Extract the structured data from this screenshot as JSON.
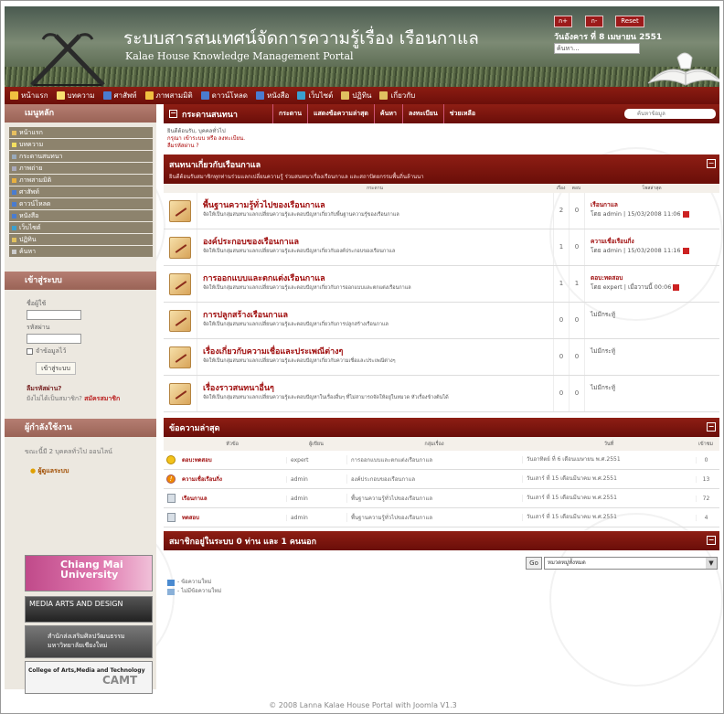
{
  "header": {
    "title": "ระบบสารสนเทศน์จัดการความรู้เรื่อง เรือนกาแล",
    "subtitle": "Kalae House Knowledge Management Portal",
    "font_buttons": [
      "ก+",
      "ก-",
      "Reset"
    ],
    "date": "วันอังคาร ที่ 8 เมษายน 2551",
    "search_value": "ค้นหา..."
  },
  "nav": [
    {
      "label": "หน้าแรก",
      "color": "#f0c040"
    },
    {
      "label": "บทความ",
      "color": "#f7e070"
    },
    {
      "label": "ศาสัพท์",
      "color": "#4a7cd0"
    },
    {
      "label": "ภาพสามมิติ",
      "color": "#f0c040"
    },
    {
      "label": "ดาวน์โหลด",
      "color": "#4a7cd0"
    },
    {
      "label": "หนังสือ",
      "color": "#4a7cd0"
    },
    {
      "label": "เว็บไซต์",
      "color": "#3aa0d0"
    },
    {
      "label": "ปฏิทิน",
      "color": "#e0c060"
    },
    {
      "label": "เกี่ยวกับ",
      "color": "#e0c060"
    }
  ],
  "sidebar": {
    "menu_title": "เมนูหลัก",
    "menu": [
      "หน้าแรก",
      "บทความ",
      "กระดานสนทนา",
      "ภาพถ่าย",
      "ภาพสามมิติ",
      "ศาสัพท์",
      "ดาวน์โหลด",
      "หนังสือ",
      "เว็บไซต์",
      "ปฏิทิน",
      "ค้นหา"
    ],
    "login_title": "เข้าสู่ระบบ",
    "username_label": "ชื่อผู้ใช้",
    "password_label": "รหัสผ่าน",
    "remember_label": "จำข้อมูลไว้",
    "login_button": "เข้าสู่ระบบ",
    "forgot": "ลืมรหัสผ่าน?",
    "no_account": "ยังไม่ได้เป็นสมาชิก?",
    "register": "สมัครสมาชิก",
    "online_title": "ผู้กำลังใช้งาน",
    "online_text": "ขณะนี้มี 2 บุคคลทั่วไป ออนไลน์",
    "online_user": "ผู้ดูแลระบบ",
    "banner1": "Chiang Mai University",
    "banner2": "MEDIA ARTS AND DESIGN",
    "banner3": "สำนักส่งเสริมศิลปวัฒนธรรม มหาวิทยาลัยเชียงใหม่",
    "banner4a": "College of Arts,Media and Technology",
    "banner4b": "CAMT"
  },
  "forum": {
    "bar_title": "กระดานสนทนา",
    "tabs": [
      "กระดาน",
      "แสดงข้อความล่าสุด",
      "ค้นหา",
      "ลงทะเบียน",
      "ช่วยเหลือ"
    ],
    "search_placeholder": "ค้นหาข้อมูล",
    "welcome_line1": "ยินดีต้อนรับ, บุคคลทั่วไป",
    "welcome_line2": "กรุณา เข้าระบบ หรือ ลงทะเบียน.",
    "welcome_line3": "ลืมรหัสผ่าน ?",
    "category_title": "สนทนาเกี่ยวกับเรือนกาแล",
    "category_desc": "ยินดีต้อนรับสมาชิกทุกท่านร่วมแลกเปลี่ยนความรู้ ร่วมสนทนาเรื่องเรือนกาแล และสถาปัตยกรรมพื้นถิ่นล้านนา",
    "columns": [
      "กระดาน",
      "เรื่อง",
      "ตอบ",
      "โพสล่าสุด"
    ],
    "boards": [
      {
        "title": "พื้นฐานความรู้ทั่วไปของเรือนกาแล",
        "desc": "จัดให้เป็นกลุ่มสนทนาแลกเปลี่ยนความรู้และตอบปัญหาเกี่ยวกับพื้นฐานความรู้ของเรือนกาแล",
        "topics": "2",
        "replies": "0",
        "last_title": "เรือนกาแล",
        "last_by": "โดย admin | 15/03/2008 11:06"
      },
      {
        "title": "องค์ประกอบของเรือนกาแล",
        "desc": "จัดให้เป็นกลุ่มสนทนาแลกเปลี่ยนความรู้และตอบปัญหาเกี่ยวกับองค์ประกอบของเรือนกาแล",
        "topics": "1",
        "replies": "0",
        "last_title": "ความเชื่อเรือนกิ่ง",
        "last_by": "โดย admin | 15/03/2008 11:16"
      },
      {
        "title": "การออกแบบและตกแต่งเรือนกาแล",
        "desc": "จัดให้เป็นกลุ่มสนทนาแลกเปลี่ยนความรู้และตอบปัญหาเกี่ยวกับการออกแบบและตกแต่งเรือนกาแล",
        "topics": "1",
        "replies": "1",
        "last_title": "ตอบ:ทดสอบ",
        "last_by": "โดย expert | เมื่อวานนี้ 00:06"
      },
      {
        "title": "การปลูกสร้างเรือนกาแล",
        "desc": "จัดให้เป็นกลุ่มสนทนาแลกเปลี่ยนความรู้และตอบปัญหาเกี่ยวกับการปลูกสร้างเรือนกาแล",
        "topics": "0",
        "replies": "0",
        "last_title": "",
        "last_by": "ไม่มีกระทู้"
      },
      {
        "title": "เรื่องเกี่ยวกับความเชื่อและประเพณีต่างๆ",
        "desc": "จัดให้เป็นกลุ่มสนทนาแลกเปลี่ยนความรู้และตอบปัญหาเกี่ยวกับความเชื่อและประเพณีต่างๆ",
        "topics": "0",
        "replies": "0",
        "last_title": "",
        "last_by": "ไม่มีกระทู้"
      },
      {
        "title": "เรื่องราวสนทนาอื่นๆ",
        "desc": "จัดให้เป็นกลุ่มสนทนาแลกเปลี่ยนความรู้และตอบปัญหาในเรื่องอื่นๆ ที่ไม่สามารถจัดให้อยู่ในหมวด หัวเรื่องข้างต้นได้",
        "topics": "0",
        "replies": "0",
        "last_title": "",
        "last_by": "ไม่มีกระทู้"
      }
    ],
    "latest_title": "ข้อความล่าสุด",
    "latest_columns": [
      "หัวข้อ",
      "ผู้เขียน",
      "กลุ่มเรื่อง",
      "วันที่",
      "เข้าชม"
    ],
    "latest": [
      {
        "icon": "smile",
        "topic": "ตอบ:ทดสอบ",
        "author": "expert",
        "board": "การออกแบบและตกแต่งเรือนกาแล",
        "date": "วันอาทิตย์ ที่ 6 เดือนเมษายน พ.ศ.2551",
        "views": "0"
      },
      {
        "icon": "warn",
        "topic": "ความเชื่อเรือนกิ่ง",
        "author": "admin",
        "board": "องค์ประกอบของเรือนกาแล",
        "date": "วันเสาร์ ที่ 15 เดือนมีนาคม พ.ศ.2551",
        "views": "13"
      },
      {
        "icon": "doc",
        "topic": "เรือนกาแล",
        "author": "admin",
        "board": "พื้นฐานความรู้ทั่วไปของเรือนกาแล",
        "date": "วันเสาร์ ที่ 15 เดือนมีนาคม พ.ศ.2551",
        "views": "72"
      },
      {
        "icon": "doc",
        "topic": "ทดสอบ",
        "author": "admin",
        "board": "พื้นฐานความรู้ทั่วไปของเรือนกาแล",
        "date": "วันเสาร์ ที่ 15 เดือนมีนาคม พ.ศ.2551",
        "views": "4"
      }
    ],
    "online_bar": "สมาชิกอยู่ในระบบ 0 ท่าน และ 1 คนนอก",
    "go_label": "Go",
    "jump_value": "หมวดหมู่ทั้งหมด",
    "legend_new": "- ข้อความใหม่",
    "legend_old": "- ไม่มีข้อความใหม่"
  },
  "footer": "© 2008 Lanna Kalae House Portal with Joomla V1.3"
}
